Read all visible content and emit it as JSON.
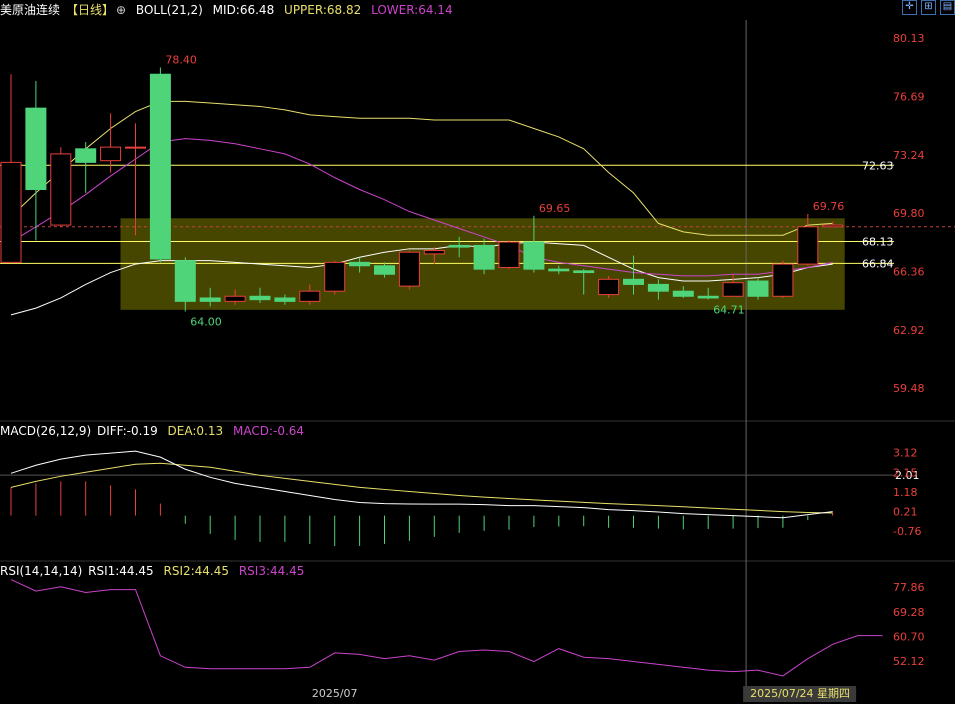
{
  "header": {
    "instrument": "美原油连续",
    "period": "【日线】",
    "indicator": "BOLL(21,2)",
    "mid_label": "MID:66.48",
    "upper_label": "UPPER:68.82",
    "lower_label": "LOWER:64.14"
  },
  "toolbar": {
    "icons": [
      "crosshair-icon",
      "zoom-icon",
      "layout-icon"
    ]
  },
  "macd_header": {
    "name": "MACD(26,12,9)",
    "diff": "DIFF:-0.19",
    "dea": "DEA:0.13",
    "macd": "MACD:-0.64"
  },
  "rsi_header": {
    "name": "RSI(14,14,14)",
    "rsi1": "RSI1:44.45",
    "rsi2": "RSI2:44.45",
    "rsi3": "RSI3:44.45"
  },
  "colors": {
    "up": "#e8403c",
    "down": "#4fd47a",
    "mid": "#ffffff",
    "upper": "#e8e06a",
    "lower": "#cc44cc",
    "hline": "#ffff66",
    "zone": "#808000",
    "dea": "#e8e06a",
    "rsi": "#cc44cc"
  },
  "chart_data": [
    {
      "type": "candlestick",
      "name": "price",
      "y_ticks": [
        80.13,
        76.69,
        73.24,
        69.8,
        66.36,
        62.92,
        59.48
      ],
      "ylim": [
        57.6,
        81.2
      ],
      "horizontal_lines": [
        {
          "value": 72.63,
          "label": "72.63"
        },
        {
          "value": 68.13,
          "label": "68.13"
        },
        {
          "value": 66.84,
          "label": "66.84"
        }
      ],
      "current_price_dashed": 69.0,
      "zone": {
        "from_index": 5,
        "to_index": 33,
        "y_low": 64.1,
        "y_high": 69.5
      },
      "annotations": [
        {
          "index": 6,
          "value": 78.4,
          "label": "78.40",
          "color": "#e8403c"
        },
        {
          "index": 7,
          "value": 64.0,
          "label": "64.00",
          "color": "#4fd47a"
        },
        {
          "index": 21,
          "value": 69.65,
          "label": "69.65",
          "color": "#e8403c"
        },
        {
          "index": 28,
          "value": 64.71,
          "label": "64.71",
          "color": "#4fd47a"
        },
        {
          "index": 32,
          "value": 69.76,
          "label": "69.76",
          "color": "#e8403c"
        }
      ],
      "crosshair_index": 29,
      "x_labels": [
        {
          "index": 13,
          "text": "2025/07"
        }
      ],
      "crosshair_label": "2025/07/24 星期四",
      "candles": [
        {
          "o": 66.9,
          "h": 78.0,
          "l": 67.5,
          "c": 72.8
        },
        {
          "o": 76.0,
          "h": 77.6,
          "l": 68.2,
          "c": 71.2
        },
        {
          "o": 69.1,
          "h": 73.7,
          "l": 69.0,
          "c": 73.3
        },
        {
          "o": 73.6,
          "h": 74.0,
          "l": 71.0,
          "c": 72.8
        },
        {
          "o": 72.9,
          "h": 75.7,
          "l": 72.2,
          "c": 73.7
        },
        {
          "o": 73.7,
          "h": 75.1,
          "l": 68.5,
          "c": 73.7
        },
        {
          "o": 78.0,
          "h": 78.4,
          "l": 66.9,
          "c": 67.1
        },
        {
          "o": 67.0,
          "h": 67.2,
          "l": 64.0,
          "c": 64.6
        },
        {
          "o": 64.8,
          "h": 65.4,
          "l": 64.3,
          "c": 64.6
        },
        {
          "o": 64.6,
          "h": 65.3,
          "l": 64.4,
          "c": 64.9
        },
        {
          "o": 64.9,
          "h": 65.4,
          "l": 64.5,
          "c": 64.7
        },
        {
          "o": 64.8,
          "h": 65.0,
          "l": 64.4,
          "c": 64.6
        },
        {
          "o": 64.6,
          "h": 65.6,
          "l": 64.4,
          "c": 65.2
        },
        {
          "o": 65.2,
          "h": 67.0,
          "l": 65.0,
          "c": 66.9
        },
        {
          "o": 66.9,
          "h": 67.2,
          "l": 66.3,
          "c": 66.7
        },
        {
          "o": 66.7,
          "h": 66.9,
          "l": 66.0,
          "c": 66.2
        },
        {
          "o": 65.5,
          "h": 67.6,
          "l": 65.3,
          "c": 67.5
        },
        {
          "o": 67.4,
          "h": 67.8,
          "l": 66.8,
          "c": 67.6
        },
        {
          "o": 67.9,
          "h": 68.4,
          "l": 67.2,
          "c": 67.8
        },
        {
          "o": 67.9,
          "h": 68.3,
          "l": 66.2,
          "c": 66.5
        },
        {
          "o": 66.6,
          "h": 68.2,
          "l": 66.5,
          "c": 68.1
        },
        {
          "o": 68.1,
          "h": 69.65,
          "l": 66.3,
          "c": 66.5
        },
        {
          "o": 66.5,
          "h": 66.7,
          "l": 66.2,
          "c": 66.4
        },
        {
          "o": 66.4,
          "h": 66.5,
          "l": 65.0,
          "c": 66.3
        },
        {
          "o": 65.0,
          "h": 66.1,
          "l": 64.8,
          "c": 65.9
        },
        {
          "o": 65.9,
          "h": 67.3,
          "l": 65.0,
          "c": 65.6
        },
        {
          "o": 65.6,
          "h": 65.9,
          "l": 64.7,
          "c": 65.2
        },
        {
          "o": 65.2,
          "h": 65.5,
          "l": 64.8,
          "c": 64.9
        },
        {
          "o": 64.9,
          "h": 65.4,
          "l": 64.71,
          "c": 64.8
        },
        {
          "o": 64.9,
          "h": 66.2,
          "l": 64.9,
          "c": 65.7
        },
        {
          "o": 65.8,
          "h": 66.0,
          "l": 64.7,
          "c": 64.9
        },
        {
          "o": 64.9,
          "h": 67.0,
          "l": 64.8,
          "c": 66.8
        },
        {
          "o": 66.8,
          "h": 69.76,
          "l": 66.7,
          "c": 69.0
        },
        {
          "o": 69.0,
          "h": 69.3,
          "l": 69.0,
          "c": 69.1
        }
      ],
      "boll_mid": [
        68.1,
        69.0,
        69.9,
        70.9,
        72.0,
        73.0,
        74.0,
        74.2,
        74.1,
        73.9,
        73.6,
        73.3,
        72.7,
        71.9,
        71.2,
        70.6,
        69.9,
        69.4,
        68.9,
        68.4,
        67.9,
        67.2,
        66.9,
        66.7,
        66.5,
        66.3,
        66.2,
        66.1,
        66.1,
        66.2,
        66.2,
        66.4,
        66.6,
        66.9
      ],
      "boll_upper": [
        69.6,
        71.0,
        72.3,
        73.6,
        74.8,
        75.8,
        76.4,
        76.4,
        76.3,
        76.2,
        76.1,
        75.9,
        75.6,
        75.5,
        75.4,
        75.4,
        75.4,
        75.3,
        75.3,
        75.3,
        75.3,
        74.8,
        74.3,
        73.6,
        72.2,
        71.0,
        69.2,
        68.7,
        68.5,
        68.5,
        68.5,
        68.5,
        69.1,
        69.2
      ],
      "boll_lower": [
        63.8,
        64.2,
        64.8,
        65.6,
        66.3,
        66.8,
        67.0,
        67.0,
        67.0,
        66.9,
        66.8,
        66.7,
        66.6,
        66.8,
        67.2,
        67.5,
        67.7,
        67.7,
        67.9,
        67.8,
        68.0,
        68.1,
        68.0,
        67.9,
        67.2,
        66.5,
        66.0,
        65.8,
        65.8,
        65.9,
        66.0,
        66.2,
        66.6,
        66.8
      ]
    },
    {
      "type": "macd",
      "name": "MACD",
      "y_ticks": [
        3.12,
        2.15,
        1.18,
        0.21,
        -0.76
      ],
      "ylim": [
        -1.8,
        3.7
      ],
      "horizontal_lines": [
        {
          "value": 2.01,
          "label": "2.01"
        }
      ],
      "diff": [
        2.1,
        2.5,
        2.8,
        3.0,
        3.1,
        3.2,
        2.9,
        2.3,
        1.9,
        1.6,
        1.4,
        1.2,
        1.0,
        0.8,
        0.65,
        0.6,
        0.58,
        0.57,
        0.57,
        0.55,
        0.5,
        0.5,
        0.45,
        0.4,
        0.3,
        0.25,
        0.18,
        0.1,
        0.05,
        0.0,
        -0.05,
        -0.1,
        0.05,
        0.2
      ],
      "dea": [
        1.4,
        1.7,
        1.95,
        2.15,
        2.35,
        2.55,
        2.6,
        2.5,
        2.4,
        2.2,
        2.0,
        1.85,
        1.7,
        1.55,
        1.4,
        1.3,
        1.2,
        1.1,
        1.0,
        0.92,
        0.85,
        0.78,
        0.72,
        0.66,
        0.6,
        0.55,
        0.5,
        0.44,
        0.38,
        0.32,
        0.26,
        0.2,
        0.16,
        0.13
      ],
      "macd": [
        1.4,
        1.6,
        1.7,
        1.7,
        1.5,
        1.3,
        0.6,
        -0.4,
        -0.9,
        -1.2,
        -1.3,
        -1.3,
        -1.4,
        -1.5,
        -1.5,
        -1.4,
        -1.25,
        -1.05,
        -0.85,
        -0.75,
        -0.7,
        -0.56,
        -0.54,
        -0.52,
        -0.6,
        -0.6,
        -0.64,
        -0.68,
        -0.66,
        -0.64,
        -0.62,
        -0.6,
        -0.22,
        0.14
      ]
    },
    {
      "type": "line",
      "name": "RSI",
      "y_ticks": [
        77.86,
        69.28,
        60.7,
        52.12
      ],
      "ylim": [
        43.5,
        80.0
      ],
      "rsi": [
        80.5,
        76.5,
        78.0,
        76.0,
        77.0,
        77.0,
        54.0,
        50.0,
        49.5,
        49.5,
        49.5,
        49.5,
        50.0,
        55.0,
        54.5,
        53.0,
        54.0,
        52.5,
        55.5,
        56.0,
        55.5,
        52.0,
        56.5,
        53.5,
        53.0,
        52.0,
        51.0,
        50.0,
        49.0,
        48.5,
        49.0,
        47.0,
        53.0,
        58.0,
        61.0,
        61.0
      ]
    }
  ]
}
